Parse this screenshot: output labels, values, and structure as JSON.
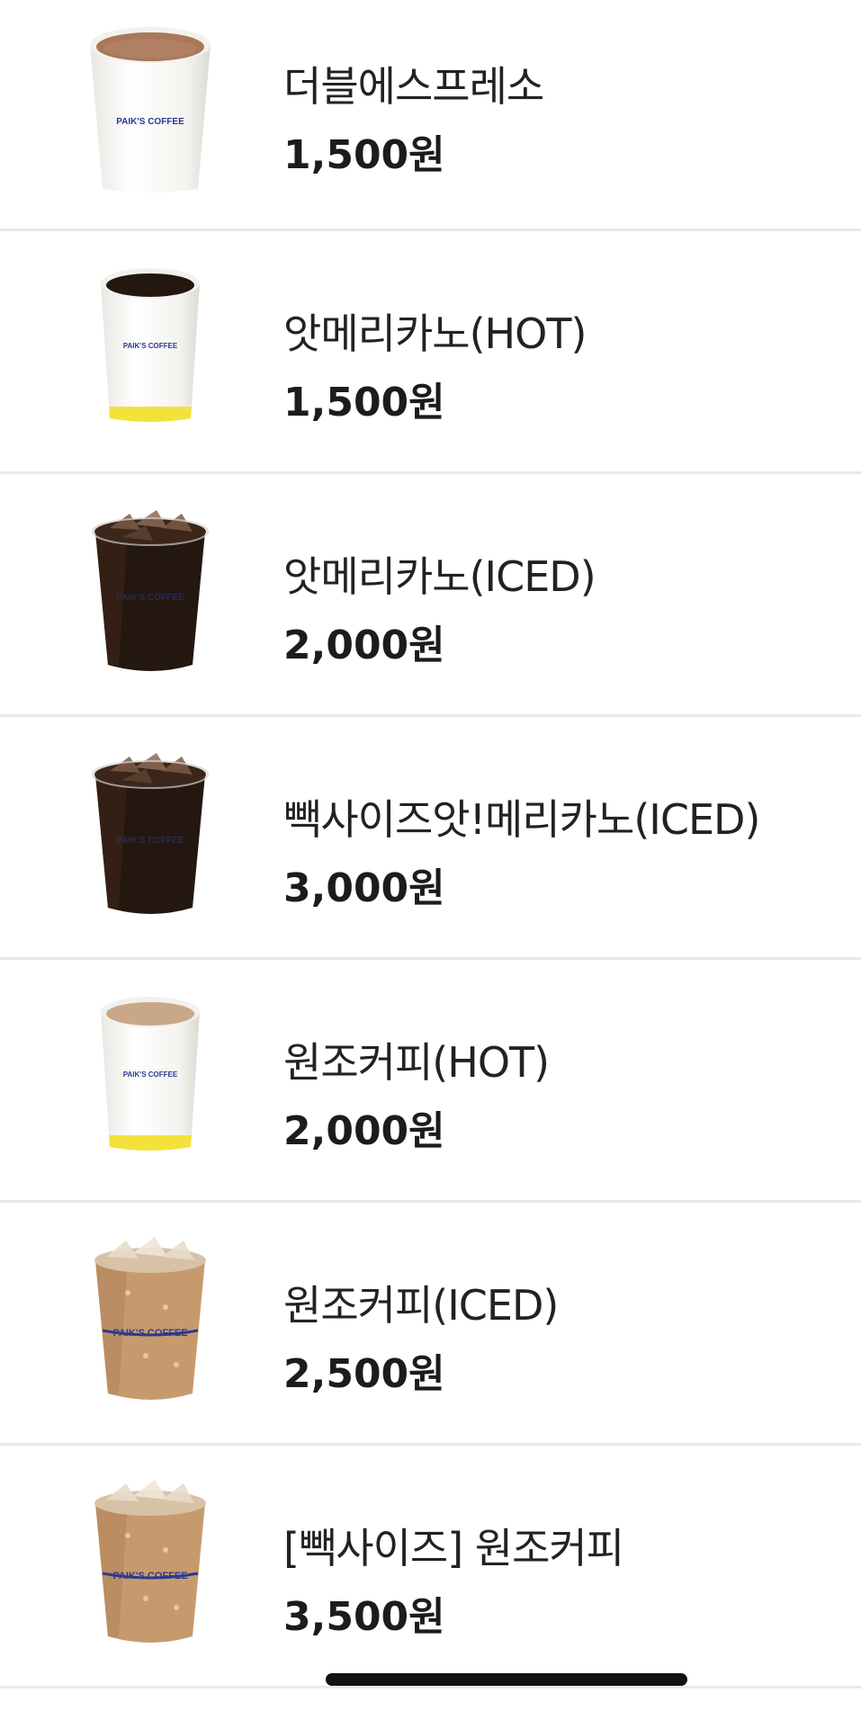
{
  "items": [
    {
      "name": "더블에스프레소",
      "price": "1,500원",
      "cup_label": "PAIK'S COFFEE",
      "cup": "hot-espresso"
    },
    {
      "name": "앗메리카노(HOT)",
      "price": "1,500원",
      "cup_label": "PAIK'S COFFEE",
      "cup": "hot-americano"
    },
    {
      "name": "앗메리카노(ICED)",
      "price": "2,000원",
      "cup_label": "PAIK'S COFFEE",
      "cup": "iced-americano"
    },
    {
      "name": "빽사이즈앗!메리카노(ICED)",
      "price": "3,000원",
      "cup_label": "PAIK'S COFFEE",
      "cup": "iced-americano"
    },
    {
      "name": "원조커피(HOT)",
      "price": "2,000원",
      "cup_label": "PAIK'S COFFEE",
      "cup": "hot-latte"
    },
    {
      "name": "원조커피(ICED)",
      "price": "2,500원",
      "cup_label": "PAIK'S COFFEE",
      "cup": "iced-latte"
    },
    {
      "name": "[빽사이즈] 원조커피",
      "price": "3,500원",
      "cup_label": "PAIK'S COFFEE",
      "cup": "iced-latte"
    }
  ],
  "colors": {
    "brand_blue": "#2b3a8f",
    "cup_yellow": "#f3e23a",
    "espresso": "#a87857",
    "americano": "#241710",
    "latte_hot": "#c9a88a",
    "latte_iced": "#c79a6e"
  }
}
